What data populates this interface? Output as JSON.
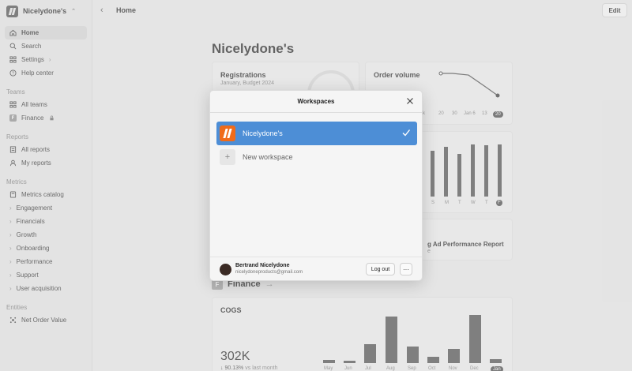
{
  "sidebar": {
    "workspace_name": "Nicelydone's",
    "items": {
      "home": "Home",
      "search": "Search",
      "settings": "Settings",
      "help": "Help center"
    },
    "sections": {
      "teams": "Teams",
      "reports": "Reports",
      "metrics": "Metrics",
      "entities": "Entities"
    },
    "teams": {
      "all": "All teams",
      "finance": "Finance",
      "finance_badge": "F"
    },
    "reports": {
      "all": "All reports",
      "mine": "My reports"
    },
    "metrics": [
      "Metrics catalog",
      "Engagement",
      "Financials",
      "Growth",
      "Onboarding",
      "Performance",
      "Support",
      "User acquisition"
    ],
    "entities": {
      "net_order_value": "Net Order Value"
    }
  },
  "topbar": {
    "title": "Home",
    "edit_label": "Edit"
  },
  "main": {
    "title": "Nicelydone's",
    "registrations": {
      "title": "Registrations",
      "subtitle": "January, Budget 2024"
    },
    "order_volume": {
      "title": "Order volume",
      "axis": [
        "8",
        "20",
        "30",
        "Jan 6",
        "13",
        "20"
      ],
      "axis_first": "k"
    },
    "weekly": {
      "days": [
        "S",
        "M",
        "T",
        "W",
        "T",
        "F"
      ]
    },
    "report_card": {
      "title": "g Ad Performance Report",
      "sub": "e"
    },
    "finance_section": {
      "title": "Finance",
      "arrow": "→",
      "badge": "F"
    },
    "cogs": {
      "title": "COGS",
      "value": "302K",
      "change": "90.13%",
      "change_suffix": "vs last month",
      "arrow": "↓"
    }
  },
  "modal": {
    "title": "Workspaces",
    "workspace": "Nicelydone's",
    "new_workspace": "New workspace",
    "user_name": "Bertrand Nicelydone",
    "user_email": "nicelydoneproducts@gmail.com",
    "logout": "Log out",
    "more": "···"
  },
  "chart_data": [
    {
      "type": "line",
      "title": "Order volume",
      "x": [
        "20",
        "30",
        "Jan 6",
        "13",
        "20"
      ],
      "values": [
        4.6,
        4.6,
        4.4,
        3.0,
        1.9
      ]
    },
    {
      "type": "bar",
      "categories": [
        "S",
        "M",
        "T",
        "W",
        "T",
        "F"
      ],
      "values": [
        0.88,
        0.95,
        0.82,
        1.0,
        0.98,
        1.0
      ]
    },
    {
      "type": "bar",
      "title": "COGS",
      "categories": [
        "May",
        "Jun",
        "Jul",
        "Aug",
        "Sep",
        "Oct",
        "Nov",
        "Dec",
        "Jan"
      ],
      "values": [
        6,
        5,
        40,
        97,
        34,
        13,
        30,
        100,
        8
      ]
    }
  ],
  "colors": {
    "accent": "#4d8ed6",
    "logo": "#f06b1a"
  }
}
